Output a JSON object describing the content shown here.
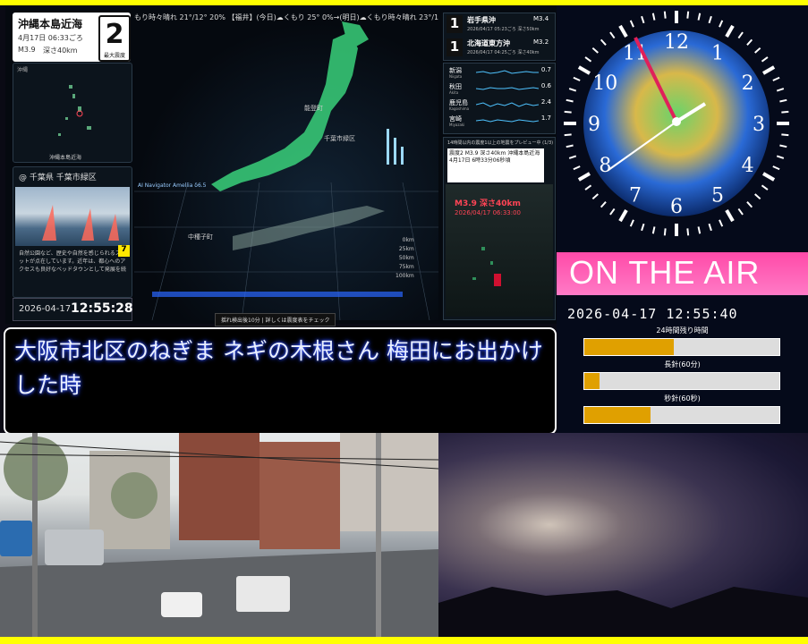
{
  "quake": {
    "place": "沖縄本島近海",
    "time": "4月17日 06:33ごろ",
    "mag": "M3.9",
    "depth": "深さ40km",
    "intensity": "2",
    "intensity_label": "最大震度",
    "weather_ticker": "もり時々晴れ 21°/12° 20% 【福井】(今日)☁くもり 25° 0%→(明日)☁くもり時々晴れ 23°/13° 20% 【山】",
    "minimap_label": "沖縄",
    "minimap_footer": "沖縄本島近海",
    "map_label_a": "能登町",
    "map_label_b": "千葉市緑区",
    "map_label_c": "中種子町",
    "navi_label": "AI Navigator Ameliia δ6.5",
    "hint": "揺れ検出後10分 | 詳しくは震度表をチェック",
    "scale": [
      "0km",
      "25km",
      "50km",
      "75km",
      "100km"
    ]
  },
  "camera": {
    "title": "@ 千葉県 千葉市緑区",
    "desc": "自然公園など、歴史や自然を感じられるスポットが点在しています。近年は、都心へのアクセスも良好なベッドタウンとして発展を続",
    "badge": "7",
    "date": "2026-04-17",
    "time": "12:55:28"
  },
  "recent": [
    {
      "num": "1",
      "place": "岩手県沖",
      "mag": "M3.4",
      "time": "2026/04/17 05:23ごろ 深さ50km"
    },
    {
      "num": "1",
      "place": "北海道東方沖",
      "mag": "M3.2",
      "time": "2026/04/17 04:25ごろ 深さ40km"
    }
  ],
  "sensors": [
    {
      "name": "新潟",
      "en": "Niigata",
      "val": "0.7"
    },
    {
      "name": "秋田",
      "en": "Akita",
      "val": "0.6"
    },
    {
      "name": "鹿児島",
      "en": "Kagoshima",
      "val": "2.4"
    },
    {
      "name": "宮崎",
      "en": "Miyazaki",
      "val": "1.7"
    }
  ],
  "preview": {
    "head": "14時間以内の震度1以上の地震をプレビュー中 (1/3)",
    "info": "震度2 M3.9 深さ40km 沖縄本島近海 4月17日 6時33分06秒頃",
    "mag": "M3.9 深さ40km",
    "ts": "2026/04/17 06:33:00"
  },
  "clock": {
    "onair": "ON THE AIR",
    "datetime": "2026-04-17 12:55:40",
    "bars": [
      {
        "label": "24時間残り時間",
        "fill": 0.46
      },
      {
        "label": "長針(60分)",
        "fill": 0.08
      },
      {
        "label": "秒針(60秒)",
        "fill": 0.34
      }
    ],
    "hours": [
      "12",
      "1",
      "2",
      "3",
      "4",
      "5",
      "6",
      "7",
      "8",
      "9",
      "10",
      "11"
    ]
  },
  "caption": {
    "text": "大阪市北区のねぎま ネギの木根さん 梅田にお出かけした時"
  },
  "colors": {
    "accent": "#ffff00",
    "onair_pink": "#ff4aa8",
    "bar_fill": "#e0a000",
    "alert_red": "#ff4455"
  }
}
